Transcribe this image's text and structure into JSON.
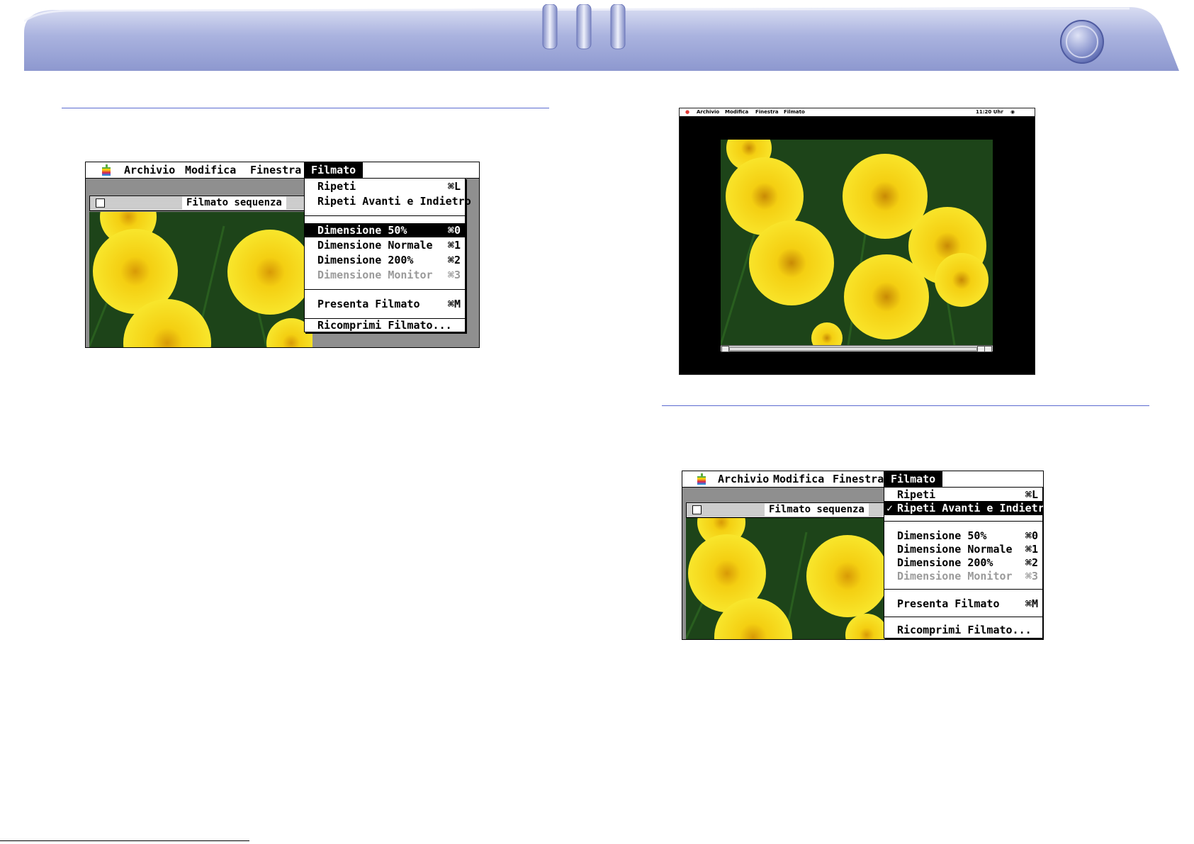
{
  "colors": {
    "header": "#a7b1df",
    "rule": "#5b6bd0",
    "menu_highlight": "#000000",
    "disabled": "#9a9a9a",
    "flower": "#f5d90f",
    "grass": "#173b15"
  },
  "header_icons": [
    "tab-icon",
    "tab-icon",
    "tab-icon",
    "round-button-icon"
  ],
  "shot1": {
    "menubar": {
      "apple": "apple-icon",
      "items": [
        "Archivio",
        "Modifica",
        "Finestra",
        "Filmato"
      ],
      "active": "Filmato"
    },
    "window_title": "Filmato sequenza",
    "menu": [
      {
        "label": "Ripeti",
        "shortcut": "⌘L",
        "state": "normal"
      },
      {
        "label": "Ripeti Avanti e Indietro",
        "shortcut": "",
        "state": "normal"
      },
      {
        "label": "Dimensione 50%",
        "shortcut": "⌘0",
        "state": "highlighted"
      },
      {
        "label": "Dimensione Normale",
        "shortcut": "⌘1",
        "state": "normal"
      },
      {
        "label": "Dimensione 200%",
        "shortcut": "⌘2",
        "state": "normal"
      },
      {
        "label": "Dimensione Monitor",
        "shortcut": "⌘3",
        "state": "disabled"
      },
      {
        "label": "Presenta Filmato",
        "shortcut": "⌘M",
        "state": "normal"
      },
      {
        "label": "Ricomprimi Filmato...",
        "shortcut": "",
        "state": "normal"
      }
    ]
  },
  "shot2": {
    "menubar": {
      "items": [
        "Archivio",
        "Modifica",
        "Finestra",
        "Filmato"
      ],
      "clock": "11:20 Uhr"
    }
  },
  "shot3": {
    "menubar": {
      "apple": "apple-icon",
      "items": [
        "Archivio",
        "Modifica",
        "Finestra",
        "Filmato"
      ],
      "active": "Filmato"
    },
    "window_title": "Filmato sequenza",
    "menu": [
      {
        "label": "Ripeti",
        "shortcut": "⌘L",
        "state": "normal"
      },
      {
        "label": "Ripeti Avanti e Indietro",
        "shortcut": "",
        "state": "checked-highlighted"
      },
      {
        "label": "Dimensione 50%",
        "shortcut": "⌘0",
        "state": "normal"
      },
      {
        "label": "Dimensione Normale",
        "shortcut": "⌘1",
        "state": "normal"
      },
      {
        "label": "Dimensione 200%",
        "shortcut": "⌘2",
        "state": "normal"
      },
      {
        "label": "Dimensione Monitor",
        "shortcut": "⌘3",
        "state": "disabled"
      },
      {
        "label": "Presenta Filmato",
        "shortcut": "⌘M",
        "state": "normal"
      },
      {
        "label": "Ricomprimi Filmato...",
        "shortcut": "",
        "state": "normal"
      }
    ]
  },
  "check_mark": "✓"
}
